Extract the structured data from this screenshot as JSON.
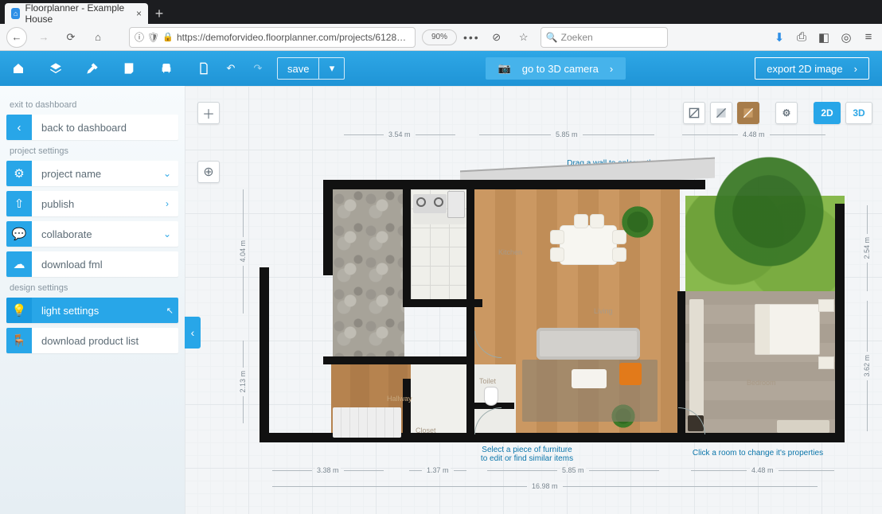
{
  "browser": {
    "tab_title": "Floorplanner - Example House",
    "url_display": "https://demoforvideo.floorplanner.com/projects/6128…",
    "zoom": "90%",
    "search_placeholder": "Zoeken"
  },
  "appbar": {
    "save_label": "save",
    "go3d_label": "go to 3D camera",
    "export_label": "export 2D image"
  },
  "sidebar": {
    "section1_title": "exit to dashboard",
    "back_label": "back to dashboard",
    "section2_title": "project settings",
    "project_name_label": "project name",
    "publish_label": "publish",
    "collaborate_label": "collaborate",
    "download_fml_label": "download fml",
    "section3_title": "design settings",
    "light_settings_label": "light settings",
    "download_products_label": "download product list"
  },
  "canvas": {
    "view_2d": "2D",
    "view_3d": "3D",
    "dims_top": [
      "3.54 m",
      "5.85 m",
      "4.48 m"
    ],
    "dims_bottom": [
      "3.38 m",
      "1.37 m",
      "5.85 m",
      "4.48 m"
    ],
    "dim_bottom_total": "16.98 m",
    "dims_left": [
      "4.04 m",
      "2.13 m"
    ],
    "dims_right": [
      "2.54 m",
      "3.62 m"
    ],
    "rooms": {
      "kitchen": "Kitchen",
      "living": "Living",
      "hallway": "Hallway",
      "toilet": "Toilet",
      "closet": "Closet",
      "bedroom": "Bedroom"
    },
    "guides": {
      "drag_wall": "Drag a wall to enlarge the room",
      "select_furniture": "Select a piece of furniture\nto edit or find similar items",
      "click_room": "Click a room to change it's properties"
    }
  }
}
